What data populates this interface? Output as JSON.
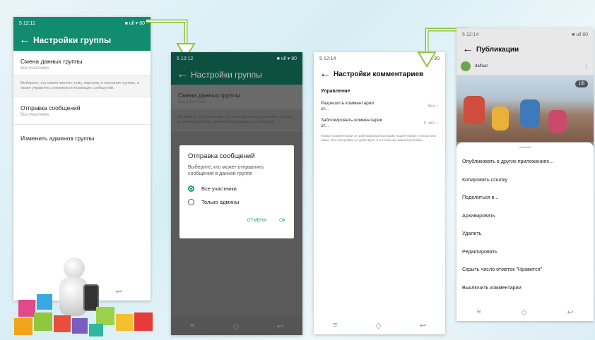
{
  "colors": {
    "whatsapp_green": "#128c6e",
    "dim_green": "#0d5042",
    "dialog_accent": "#1a9e7a",
    "arrow_green": "#8dc63f"
  },
  "screen1": {
    "status_time": "5 12:11",
    "status_icons": "■ ull ▾ 80",
    "title": "Настройки группы",
    "rows": [
      {
        "title": "Смена данных группы",
        "sub": "Все участники"
      },
      {
        "desc": "Выберите, кто может менять тему, картинку и описание группы, а также управлять режимом исчезающих сообщений."
      },
      {
        "title": "Отправка сообщений",
        "sub": "Все участники"
      },
      {
        "title": "Изменить админов группы"
      }
    ]
  },
  "screen2": {
    "status_time": "5 12:12",
    "status_icons": "■ ull ▾ 80",
    "title": "Настройки группы",
    "rows": [
      {
        "title": "Смена данных группы",
        "sub": "Все участники"
      },
      {
        "desc": "Выберите, кто может менять тему, картинку и описание группы, а также управлять режимом исчезающих сообщений."
      }
    ],
    "dialog": {
      "title": "Отправка сообщений",
      "text": "Выберите, кто может отправлять сообщения в данной группе",
      "option1": "Все участники",
      "option2": "Только админы",
      "cancel": "ОТМЕНА",
      "ok": "ОК"
    }
  },
  "screen3": {
    "status_time": "5 12:14",
    "status_icons": "■ ull 80",
    "title": "Настройки комментариев",
    "section": "Управление",
    "row1_label": "Разрешить комментарии от...",
    "row1_value": "Все",
    "row2_label": "Заблокировать комментарии от...",
    "row2_value": "0 чел.",
    "note": "Новые комментарии от заблокированных вами людей увидят только они сами. Эти настройки не действуют в отношении вашей рекламы."
  },
  "screen4": {
    "status_time": "5 12:14",
    "status_icons": "■ ull 80",
    "title": "Публикации",
    "account": "dalfaar",
    "badge": "1/8",
    "menu": [
      "Опубликовать в других приложениях...",
      "Копировать ссылку",
      "Поделиться в...",
      "Архивировать",
      "Удалить",
      "Редактировать",
      "Скрыть число отметок \"Нравится\"",
      "Выключить комментарии"
    ]
  },
  "nav": {
    "menu": "≡",
    "home": "◇",
    "back": "↩"
  }
}
